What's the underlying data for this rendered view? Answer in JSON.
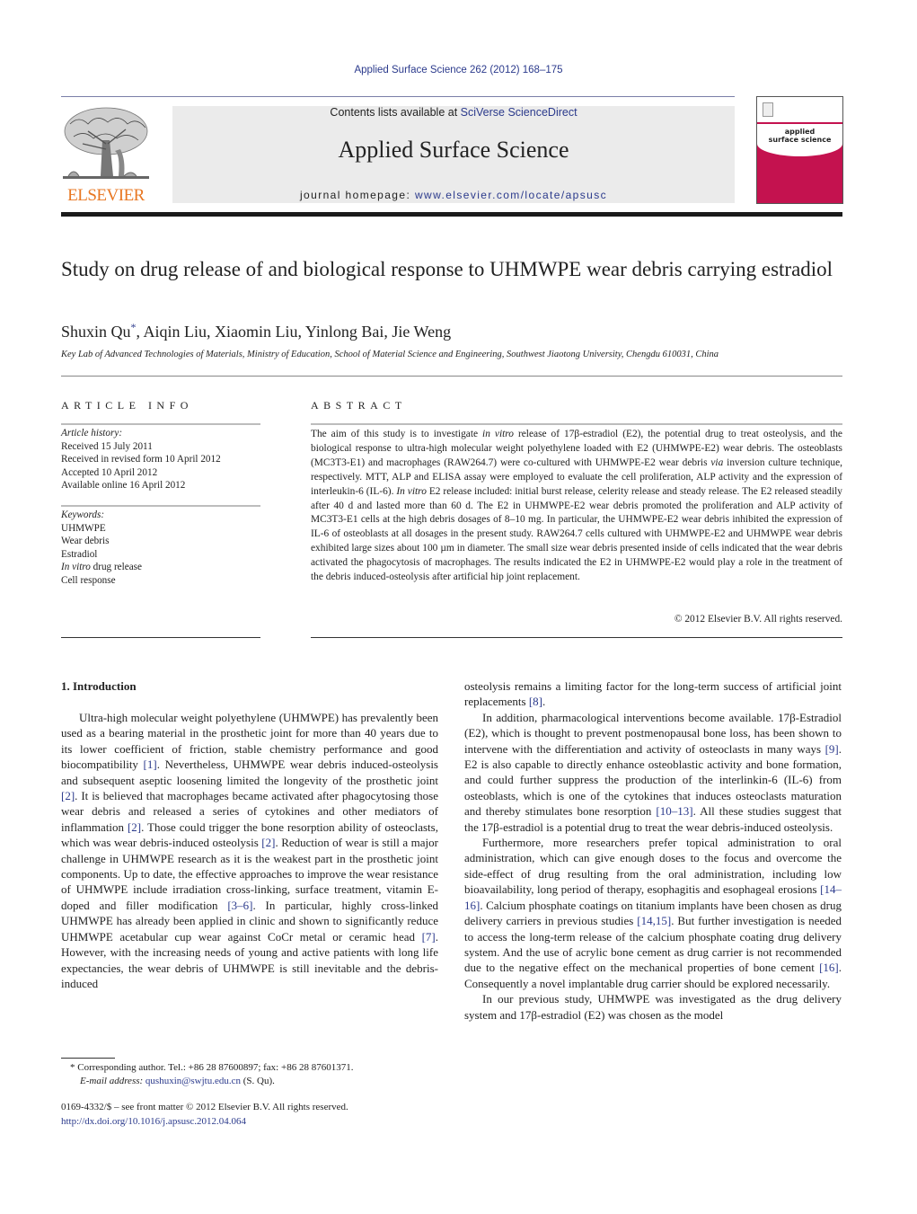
{
  "header": {
    "journal_ref": "Applied Surface Science 262 (2012) 168–175",
    "contents_prefix": "Contents lists available at ",
    "contents_link": "SciVerse ScienceDirect",
    "journal_name": "Applied Surface Science",
    "homepage_prefix": "journal homepage: ",
    "homepage_link": "www.elsevier.com/locate/apsusc",
    "publisher_logo_text": "ELSEVIER",
    "cover_title_line1": "applied",
    "cover_title_line2": "surface science"
  },
  "article": {
    "title": "Study on drug release of and biological response to UHMWPE wear debris carrying estradiol",
    "authors": [
      {
        "name": "Shuxin Qu",
        "mark": "*"
      },
      {
        "name": "Aiqin Liu"
      },
      {
        "name": "Xiaomin Liu"
      },
      {
        "name": "Yinlong Bai"
      },
      {
        "name": "Jie Weng"
      }
    ],
    "author_sep": ", ",
    "affiliation": "Key Lab of Advanced Technologies of Materials, Ministry of Education, School of Material Science and Engineering, Southwest Jiaotong University, Chengdu 610031, China"
  },
  "article_info": {
    "heading": "ARTICLE INFO",
    "history_label": "Article history:",
    "history": [
      "Received 15 July 2011",
      "Received in revised form 10 April 2012",
      "Accepted 10 April 2012",
      "Available online 16 April 2012"
    ],
    "keywords_label": "Keywords:",
    "keywords": [
      {
        "italic": "",
        "text": "UHMWPE"
      },
      {
        "italic": "",
        "text": "Wear debris"
      },
      {
        "italic": "",
        "text": "Estradiol"
      },
      {
        "italic": "In vitro",
        "text": " drug release"
      },
      {
        "italic": "",
        "text": "Cell response"
      }
    ]
  },
  "abstract": {
    "heading": "ABSTRACT",
    "segments": [
      {
        "t": "The aim of this study is to investigate "
      },
      {
        "t": "in vitro",
        "i": true
      },
      {
        "t": " release of 17β-estradiol (E2), the potential drug to treat osteolysis, and the biological response to ultra-high molecular weight polyethylene loaded with E2 (UHMWPE-E2) wear debris. The osteoblasts (MC3T3-E1) and macrophages (RAW264.7) were co-cultured with UHMWPE-E2 wear debris "
      },
      {
        "t": "via",
        "i": true
      },
      {
        "t": " inversion culture technique, respectively. MTT, ALP and ELISA assay were employed to evaluate the cell proliferation, ALP activity and the expression of interleukin-6 (IL-6). "
      },
      {
        "t": "In vitro",
        "i": true
      },
      {
        "t": " E2 release included: initial burst release, celerity release and steady release. The E2 released steadily after 40 d and lasted more than 60 d. The E2 in UHMWPE-E2 wear debris promoted the proliferation and ALP activity of MC3T3-E1 cells at the high debris dosages of 8–10 mg. In particular, the UHMWPE-E2 wear debris inhibited the expression of IL-6 of osteoblasts at all dosages in the present study. RAW264.7 cells cultured with UHMWPE-E2 and UHMWPE wear debris exhibited large sizes about 100 µm in diameter. The small size wear debris presented inside of cells indicated that the wear debris activated the phagocytosis of macrophages. The results indicated the E2 in UHMWPE-E2 would play a role in the treatment of the debris induced-osteolysis after artificial hip joint replacement."
      }
    ],
    "copyright": "© 2012 Elsevier B.V. All rights reserved."
  },
  "body": {
    "section_heading": "1.  Introduction",
    "left_paragraphs": [
      [
        {
          "t": "Ultra-high molecular weight polyethylene (UHMWPE) has prevalently been used as a bearing material in the prosthetic joint for more than 40 years due to its lower coefficient of friction, stable chemistry performance and good biocompatibility "
        },
        {
          "t": "[1]",
          "c": true
        },
        {
          "t": ". Nevertheless, UHMWPE wear debris induced-osteolysis and subsequent aseptic loosening limited the longevity of the prosthetic joint "
        },
        {
          "t": "[2]",
          "c": true
        },
        {
          "t": ". It is believed that macrophages became activated after phagocytosing those wear debris and released a series of cytokines and other mediators of inflammation "
        },
        {
          "t": "[2]",
          "c": true
        },
        {
          "t": ". Those could trigger the bone resorption ability of osteoclasts, which was wear debris-induced osteolysis "
        },
        {
          "t": "[2]",
          "c": true
        },
        {
          "t": ". Reduction of wear is still a major challenge in UHMWPE research as it is the weakest part in the prosthetic joint components. Up to date, the effective approaches to improve the wear resistance of UHMWPE include irradiation cross-linking, surface treatment, vitamin E-doped and filler modification "
        },
        {
          "t": "[3–6]",
          "c": true
        },
        {
          "t": ". In particular, highly cross-linked UHMWPE has already been applied in clinic and shown to significantly reduce UHMWPE acetabular cup wear against CoCr metal or ceramic head "
        },
        {
          "t": "[7]",
          "c": true
        },
        {
          "t": ". However, with the increasing needs of young and active patients with long life expectancies, the wear debris of UHMWPE is still inevitable and the debris-induced"
        }
      ]
    ],
    "right_continuation": [
      {
        "t": "osteolysis remains a limiting factor for the long-term success of artificial joint replacements "
      },
      {
        "t": "[8]",
        "c": true
      },
      {
        "t": "."
      }
    ],
    "right_paragraphs": [
      [
        {
          "t": "In addition, pharmacological interventions become available. 17β-Estradiol (E2), which is thought to prevent postmenopausal bone loss, has been shown to intervene with the differentiation and activity of osteoclasts in many ways "
        },
        {
          "t": "[9]",
          "c": true
        },
        {
          "t": ". E2 is also capable to directly enhance osteoblastic activity and bone formation, and could further suppress the production of the interlinkin-6 (IL-6) from osteoblasts, which is one of the cytokines that induces osteoclasts maturation and thereby stimulates bone resorption "
        },
        {
          "t": "[10–13]",
          "c": true
        },
        {
          "t": ". All these studies suggest that the 17β-estradiol is a potential drug to treat the wear debris-induced osteolysis."
        }
      ],
      [
        {
          "t": "Furthermore, more researchers prefer topical administration to oral administration, which can give enough doses to the focus and overcome the side-effect of drug resulting from the oral administration, including low bioavailability, long period of therapy, esophagitis and esophageal erosions "
        },
        {
          "t": "[14–16]",
          "c": true
        },
        {
          "t": ". Calcium phosphate coatings on titanium implants have been chosen as drug delivery carriers in previous studies "
        },
        {
          "t": "[14,15]",
          "c": true
        },
        {
          "t": ". But further investigation is needed to access the long-term release of the calcium phosphate coating drug delivery system. And the use of acrylic bone cement as drug carrier is not recommended due to the negative effect on the mechanical properties of bone cement "
        },
        {
          "t": "[16]",
          "c": true
        },
        {
          "t": ". Consequently a novel implantable drug carrier should be explored necessarily."
        }
      ],
      [
        {
          "t": "In our previous study, UHMWPE was investigated as the drug delivery system and 17β-estradiol (E2) was chosen as the model"
        }
      ]
    ]
  },
  "footnote": {
    "mark": "*",
    "corresponding": " Corresponding author. Tel.: +86 28 87600897; fax: +86 28 87601371.",
    "email_label": "E-mail address:",
    "email": "qushuxin@swjtu.edu.cn",
    "email_suffix": " (S. Qu)."
  },
  "front_matter": {
    "issn_line": "0169-4332/$ – see front matter © 2012 Elsevier B.V. All rights reserved.",
    "doi": "http://dx.doi.org/10.1016/j.apsusc.2012.04.064"
  },
  "colors": {
    "link": "#2b3a8c",
    "elsevier_orange": "#e87722",
    "cover_pink": "#c4124f",
    "masthead_bg": "#ebebeb"
  }
}
